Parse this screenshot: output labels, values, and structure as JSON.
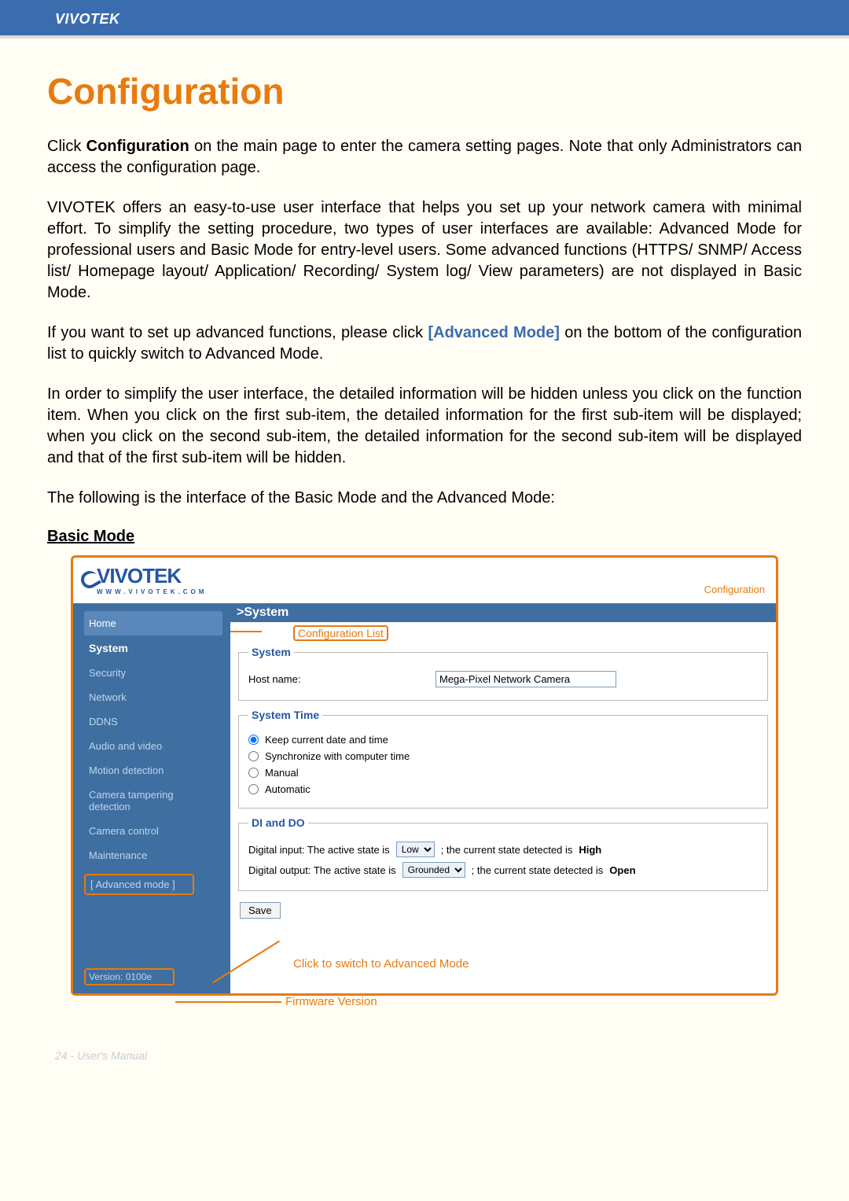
{
  "banner": "VIVOTEK",
  "title": "Configuration",
  "paragraphs": {
    "p1_a": "Click ",
    "p1_b": "Configuration",
    "p1_c": " on the main page to enter the camera setting pages. Note that only Administrators can access the configuration page.",
    "p2": "VIVOTEK offers an easy-to-use user interface that helps you set up your network camera with minimal effort. To simplify the setting procedure, two types of user interfaces are available: Advanced Mode for professional users and Basic Mode for entry-level users. Some advanced functions (HTTPS/ SNMP/ Access list/ Homepage layout/ Application/ Recording/ System log/ View parameters) are not displayed in Basic Mode.",
    "p3_a": "If you want to set up advanced functions, please click ",
    "p3_b": "[Advanced Mode]",
    "p3_c": " on the bottom of the configuration list to quickly switch to Advanced Mode.",
    "p4": "In order to simplify the user interface, the detailed information will be hidden unless you click on the function item. When you click on the first sub-item, the detailed information for the first sub-item will be displayed; when you click on the second sub-item, the detailed information for the second sub-item will be displayed and that of the first sub-item will be hidden.",
    "p5": "The following is the interface of the Basic Mode and the Advanced Mode:"
  },
  "subhead": "Basic Mode",
  "screenshot": {
    "logo_text": "VIVOTEK",
    "logo_url": "WWW.VIVOTEK.COM",
    "config_label": "Configuration",
    "sidebar": {
      "items": [
        {
          "label": "Home",
          "cls": "home"
        },
        {
          "label": "System",
          "cls": "current"
        },
        {
          "label": "Security",
          "cls": ""
        },
        {
          "label": "Network",
          "cls": ""
        },
        {
          "label": "DDNS",
          "cls": ""
        },
        {
          "label": "Audio and video",
          "cls": ""
        },
        {
          "label": "Motion detection",
          "cls": ""
        },
        {
          "label": "Camera tampering detection",
          "cls": ""
        },
        {
          "label": "Camera control",
          "cls": ""
        },
        {
          "label": "Maintenance",
          "cls": ""
        }
      ],
      "advanced": "[ Advanced mode ]",
      "version": "Version: 0100e"
    },
    "breadcrumb": ">System",
    "cfglist": "Configuration List",
    "system": {
      "legend": "System",
      "hostname_label": "Host name:",
      "hostname_value": "Mega-Pixel Network Camera"
    },
    "systime": {
      "legend": "System Time",
      "opt_keep": "Keep current date and time",
      "opt_sync": "Synchronize with computer time",
      "opt_manual": "Manual",
      "opt_auto": "Automatic"
    },
    "dido": {
      "legend": "DI and DO",
      "di_a": "Digital input: The active state is",
      "di_sel": "Low",
      "di_b": "; the current state detected is",
      "di_state": "High",
      "do_a": "Digital output: The active state is",
      "do_sel": "Grounded",
      "do_b": "; the current state detected is",
      "do_state": "Open"
    },
    "save": "Save",
    "callouts": {
      "adv": "Click to switch to Advanced Mode",
      "fw": "Firmware Version"
    }
  },
  "footer": "24 - User's Manual"
}
